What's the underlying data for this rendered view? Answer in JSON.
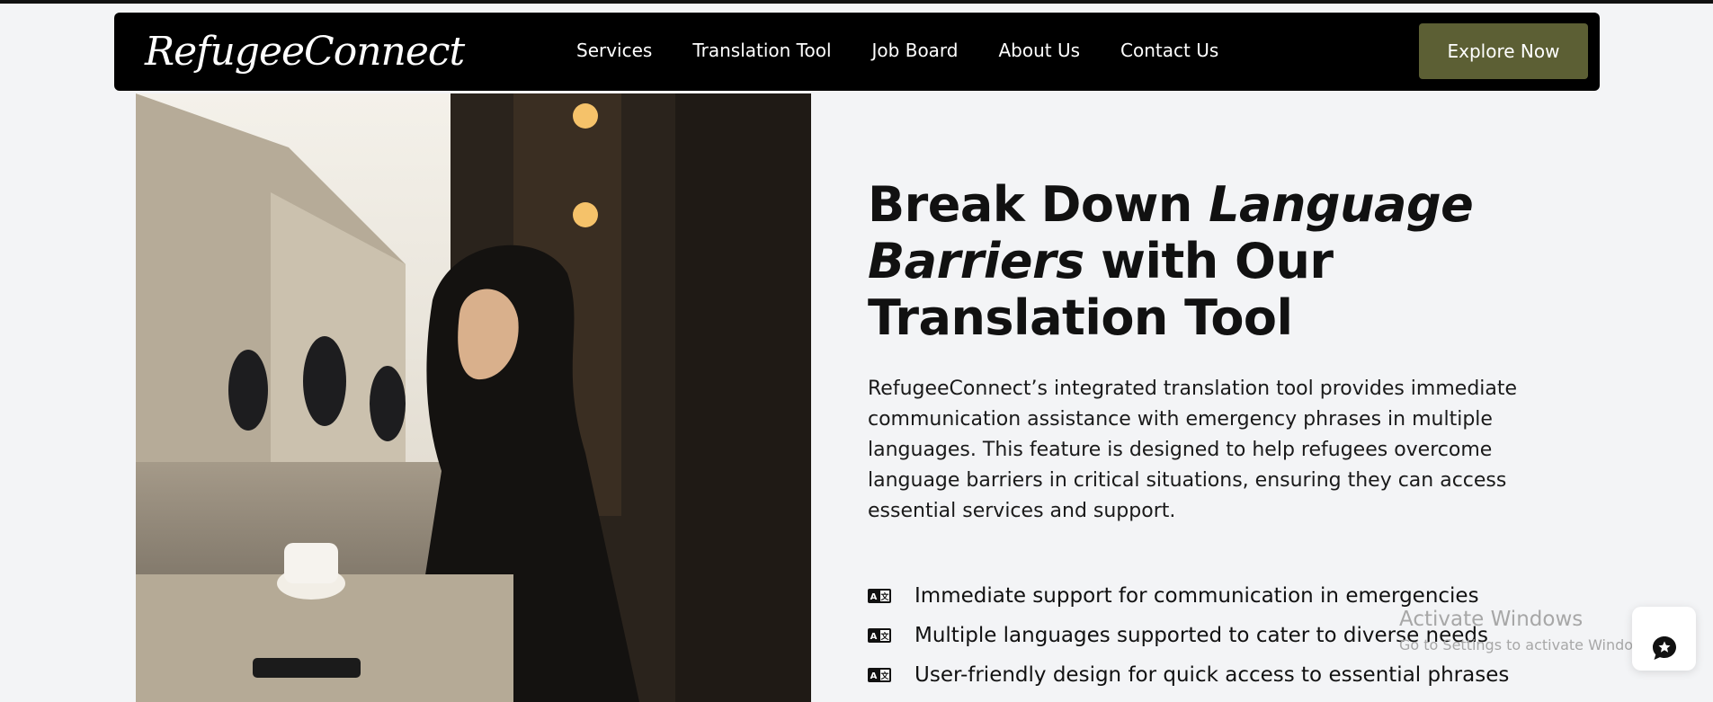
{
  "brand": {
    "name": "RefugeeConnect"
  },
  "nav": {
    "items": [
      {
        "label": "Services"
      },
      {
        "label": "Translation Tool"
      },
      {
        "label": "Job Board"
      },
      {
        "label": "About Us"
      },
      {
        "label": "Contact Us"
      }
    ],
    "cta_label": "Explore Now"
  },
  "hero": {
    "title_part1": "Break Down ",
    "title_em1": "Language Barriers",
    "title_part2": " with Our Translation Tool",
    "description": "RefugeeConnect’s integrated translation tool provides immediate communication assistance with emergency phrases in multiple languages. This feature is designed to help refugees overcome language barriers in critical situations, ensuring they can access essential services and support.",
    "features": [
      {
        "text": "Immediate support for communication in emergencies"
      },
      {
        "text": "Multiple languages supported to cater to diverse needs"
      },
      {
        "text": "User-friendly design for quick access to essential phrases"
      }
    ]
  },
  "watermark": {
    "title": "Activate Windows",
    "subtitle": "Go to Settings to activate Windows."
  },
  "icons": {
    "feature": "translate-icon",
    "chat": "chat-star-icon"
  },
  "colors": {
    "navbar": "#000000",
    "cta": "#5c5f34",
    "background": "#f3f4f6"
  }
}
